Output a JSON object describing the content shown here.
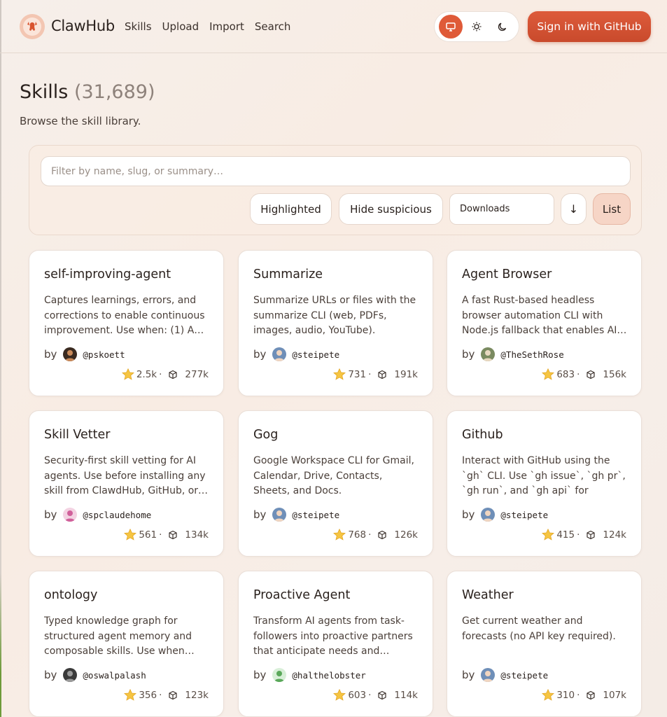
{
  "brand": {
    "name": "ClawHub"
  },
  "nav": {
    "items": [
      "Skills",
      "Upload",
      "Import",
      "Search"
    ]
  },
  "header": {
    "signin_label": "Sign in  with GitHub"
  },
  "page": {
    "title": "Skills",
    "count": "(31,689)",
    "subtitle": "Browse the skill library."
  },
  "filters": {
    "placeholder": "Filter by name, slug, or summary…",
    "highlighted": "Highlighted",
    "hide_suspicious": "Hide suspicious",
    "sort": "Downloads",
    "direction": "↓",
    "view": "List"
  },
  "cards": [
    {
      "title": "self-improving-agent",
      "desc": "Captures learnings, errors, and corrections to enable continuous improvement. Use when: (1) A…",
      "by": "by",
      "handle": "@pskoett",
      "stars": "2.5k",
      "downloads": "277k"
    },
    {
      "title": "Summarize",
      "desc": "Summarize URLs or files with the summarize CLI (web, PDFs, images, audio, YouTube).",
      "by": "by",
      "handle": "@steipete",
      "stars": "731",
      "downloads": "191k"
    },
    {
      "title": "Agent Browser",
      "desc": "A fast Rust-based headless browser automation CLI with Node.js fallback that enables AI…",
      "by": "by",
      "handle": "@TheSethRose",
      "stars": "683",
      "downloads": "156k"
    },
    {
      "title": "Skill Vetter",
      "desc": "Security-first skill vetting for AI agents. Use before installing any skill from ClawdHub, GitHub, or…",
      "by": "by",
      "handle": "@spclaudehome",
      "stars": "561",
      "downloads": "134k"
    },
    {
      "title": "Gog",
      "desc": "Google Workspace CLI for Gmail, Calendar, Drive, Contacts, Sheets, and Docs.",
      "by": "by",
      "handle": "@steipete",
      "stars": "768",
      "downloads": "126k"
    },
    {
      "title": "Github",
      "desc": "Interact with GitHub using the `gh` CLI. Use `gh issue`, `gh pr`, `gh run`, and `gh api` for issues,…",
      "by": "by",
      "handle": "@steipete",
      "stars": "415",
      "downloads": "124k"
    },
    {
      "title": "ontology",
      "desc": "Typed knowledge graph for structured agent memory and composable skills. Use when…",
      "by": "by",
      "handle": "@oswalpalash",
      "stars": "356",
      "downloads": "123k"
    },
    {
      "title": "Proactive Agent",
      "desc": "Transform AI agents from task-followers into proactive partners that anticipate needs and…",
      "by": "by",
      "handle": "@halthelobster",
      "stars": "603",
      "downloads": "114k"
    },
    {
      "title": "Weather",
      "desc": "Get current weather and forecasts (no API key required).",
      "by": "by",
      "handle": "@steipete",
      "stars": "310",
      "downloads": "107k"
    }
  ],
  "icons": {
    "logo": "lobster-icon",
    "theme_system": "monitor-icon",
    "theme_light": "sun-icon",
    "theme_dark": "moon-icon",
    "stars": "star-icon",
    "downloads": "cube-icon"
  },
  "colors": {
    "accent": "#df5a38",
    "background": "#f7eee8"
  }
}
